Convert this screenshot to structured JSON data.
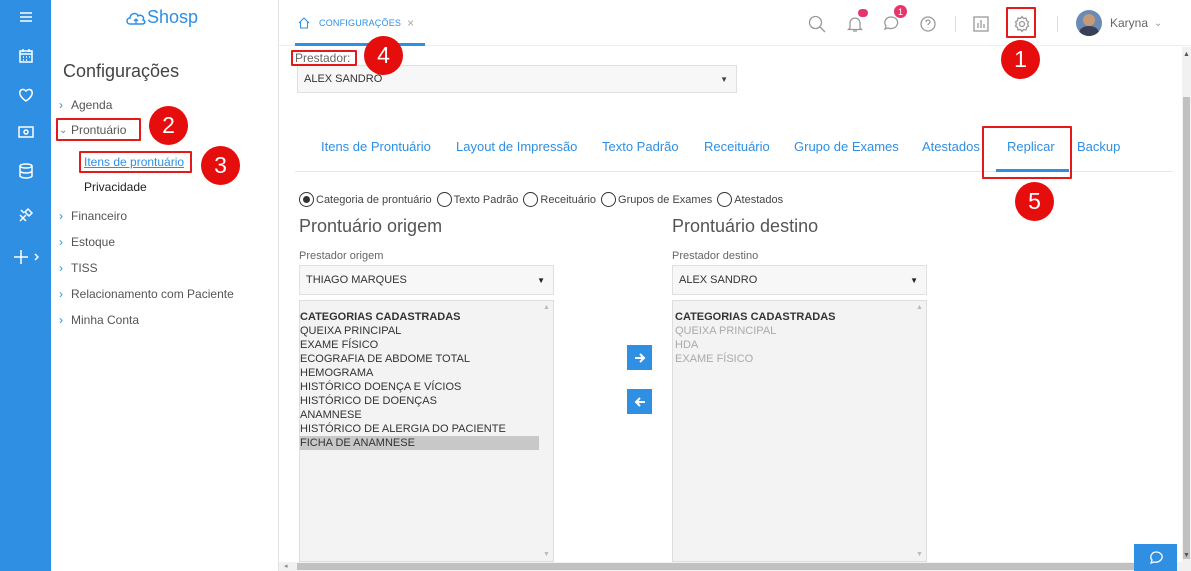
{
  "app": {
    "logo_text": "Shosp",
    "brand_color": "#2e8fe3"
  },
  "rail": {
    "icons": [
      "menu-icon",
      "calendar-icon",
      "heart-icon",
      "money-icon",
      "database-icon",
      "tools-icon",
      "plus-icon"
    ]
  },
  "sidebar": {
    "title": "Configurações",
    "items": [
      {
        "label": "Agenda"
      },
      {
        "label": "Prontuário",
        "expanded": true,
        "children": [
          {
            "label": "Itens de prontuário",
            "active": true
          },
          {
            "label": "Privacidade"
          }
        ]
      },
      {
        "label": "Financeiro"
      },
      {
        "label": "Estoque"
      },
      {
        "label": "TISS"
      },
      {
        "label": "Relacionamento com Paciente"
      },
      {
        "label": "Minha Conta"
      }
    ]
  },
  "topbar": {
    "tab_label": "CONFIGURAÇÕES",
    "tab_close": "×",
    "chat_badge": "1",
    "user_name": "Karyna"
  },
  "main": {
    "prestador_label": "Prestador:",
    "prestador_value": "ALEX SANDRO",
    "tabs": [
      "Itens de Prontuário",
      "Layout de Impressão",
      "Texto Padrão",
      "Receituário",
      "Grupo de Exames",
      "Atestados",
      "Replicar",
      "Backup"
    ],
    "active_tab": "Replicar",
    "radios": [
      {
        "label": "Categoria de prontuário",
        "checked": true
      },
      {
        "label": "Texto Padrão",
        "checked": false
      },
      {
        "label": "Receituário",
        "checked": false
      },
      {
        "label": "Grupos de Exames",
        "checked": false
      },
      {
        "label": "Atestados",
        "checked": false
      }
    ],
    "origem": {
      "title": "Prontuário origem",
      "select_label": "Prestador origem",
      "select_value": "THIAGO MARQUES",
      "list_header": "CATEGORIAS CADASTRADAS",
      "items": [
        "QUEIXA PRINCIPAL",
        "EXAME FÍSICO",
        "ECOGRAFIA DE ABDOME TOTAL",
        "HEMOGRAMA",
        "HISTÓRICO DOENÇA E VÍCIOS",
        "HISTÓRICO DE DOENÇAS",
        "ANAMNESE",
        "HISTÓRICO DE ALERGIA DO PACIENTE",
        "FICHA DE ANAMNESE"
      ],
      "selected_item": "FICHA DE ANAMNESE"
    },
    "destino": {
      "title": "Prontuário destino",
      "select_label": "Prestador destino",
      "select_value": "ALEX SANDRO",
      "list_header": "CATEGORIAS CADASTRADAS",
      "items": [
        "QUEIXA PRINCIPAL",
        "HDA",
        "EXAME FÍSICO"
      ]
    }
  },
  "annotations": [
    "1",
    "2",
    "3",
    "4",
    "5"
  ],
  "annotation_color": "#e60d0d"
}
